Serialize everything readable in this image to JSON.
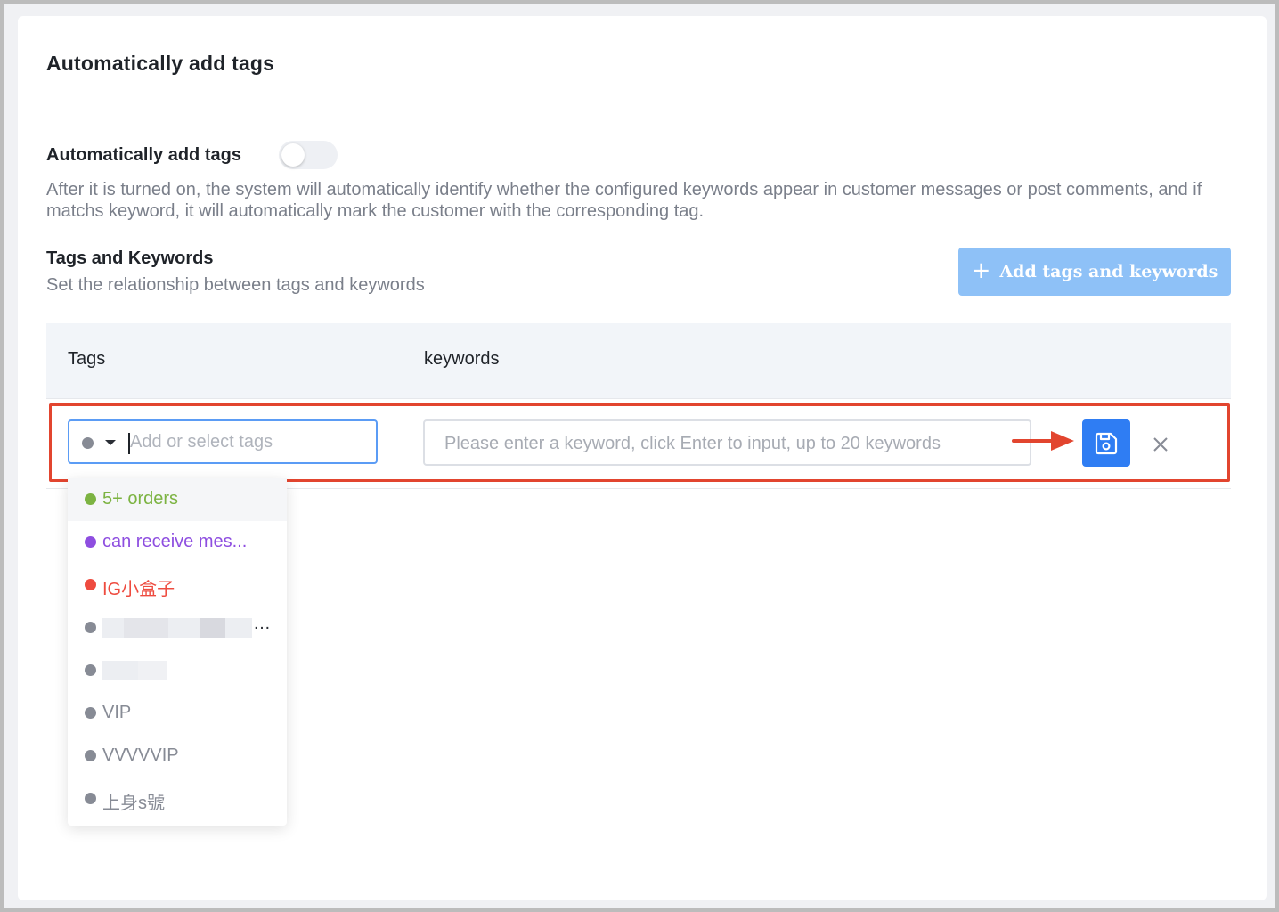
{
  "page": {
    "title": "Automatically add tags"
  },
  "auto_tag": {
    "label": "Automatically add tags",
    "enabled": false,
    "description": "After it is turned on, the system will automatically identify whether the configured keywords appear in customer messages or post comments, and if matchs keyword, it will automatically mark the customer with the corresponding tag."
  },
  "tags_section": {
    "title": "Tags and Keywords",
    "subtitle": "Set the relationship between tags and keywords",
    "add_button_label": "Add tags and keywords",
    "add_button_icon": "plus-icon"
  },
  "table": {
    "columns": [
      "Tags",
      "keywords"
    ]
  },
  "edit_row": {
    "tag_placeholder": "Add or select tags",
    "keyword_placeholder": "Please enter a keyword, click Enter to input, up to 20 keywords",
    "save_icon": "save-icon",
    "close_icon": "close-icon"
  },
  "tag_options": [
    {
      "label": "5+ orders",
      "color": "#7cb342",
      "text_color": "#7cb342",
      "active": true
    },
    {
      "label": "can receive mes...",
      "color": "#8e4ee0",
      "text_color": "#8e4ee0"
    },
    {
      "label": "IG小盒子",
      "color": "#ee4b3f",
      "text_color": "#ee4b3f"
    },
    {
      "label": "",
      "color": "#878b95",
      "redacted": true
    },
    {
      "label": "",
      "color": "#878b95",
      "redacted": true
    },
    {
      "label": "VIP",
      "color": "#878b95",
      "text_color": "#878b95"
    },
    {
      "label": "VVVVVIP",
      "color": "#878b95",
      "text_color": "#878b95"
    },
    {
      "label": "上身s號",
      "color": "#878b95",
      "text_color": "#878b95"
    }
  ],
  "colors": {
    "primary": "#2f7df3",
    "primary_light": "#8ec1f7",
    "highlight": "#e2452f"
  }
}
